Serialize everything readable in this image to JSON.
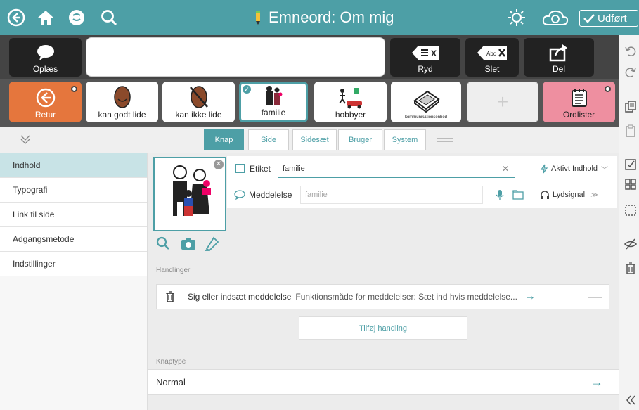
{
  "topbar": {
    "title": "Emneord: Om mig",
    "done_label": "Udført"
  },
  "msgbar": {
    "speak_label": "Oplæs",
    "clear_label": "Ryd",
    "clear_icon_text": "X",
    "delete_label": "Slet",
    "delete_icon_text": "Abc",
    "share_label": "Del"
  },
  "tiles": [
    {
      "label": "Retur"
    },
    {
      "label": "kan godt lide"
    },
    {
      "label": "kan ikke lide"
    },
    {
      "label": "familie"
    },
    {
      "label": "hobbyer"
    },
    {
      "label": "kommunikationsenhed"
    },
    {
      "label": "+"
    },
    {
      "label": "Ordlister"
    }
  ],
  "tabs": [
    "Knap",
    "Side",
    "Sidesæt",
    "Bruger",
    "System"
  ],
  "nav": [
    "Indhold",
    "Typografi",
    "Link til side",
    "Adgangsmetode",
    "Indstillinger"
  ],
  "props": {
    "label_caption": "Etiket",
    "label_value": "familie",
    "active_content": "Aktivt Indhold",
    "message_caption": "Meddelelse",
    "message_placeholder": "familie",
    "sound_signal": "Lydsignal"
  },
  "actions": {
    "section_label": "Handlinger",
    "row_title": "Sig eller indsæt meddelelse",
    "row_desc": "Funktionsmåde for meddelelser: Sæt ind hvis meddelelse...",
    "add_label": "Tilføj handling"
  },
  "knaptype": {
    "section_label": "Knaptype",
    "value": "Normal"
  }
}
